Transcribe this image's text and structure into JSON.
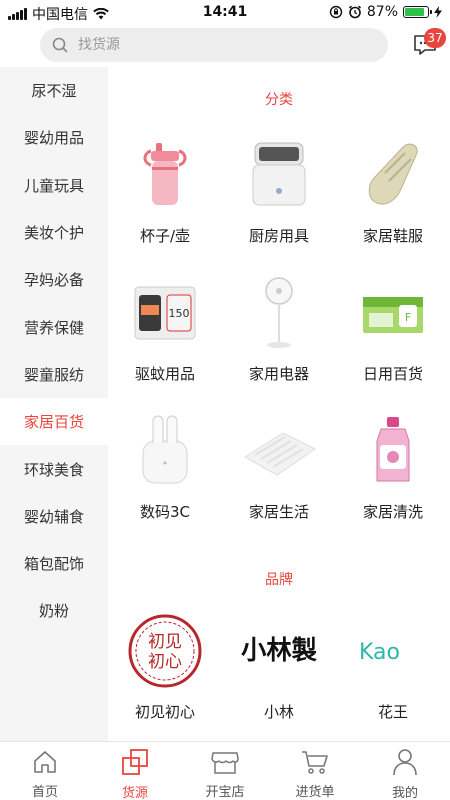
{
  "status_bar": {
    "carrier": "中国电信",
    "time": "14:41",
    "battery": "87%",
    "battery_level": 0.87
  },
  "search": {
    "placeholder": "找货源"
  },
  "messages": {
    "badge_count": "37"
  },
  "sidebar": {
    "items": [
      {
        "label": "尿不湿"
      },
      {
        "label": "婴幼用品"
      },
      {
        "label": "儿童玩具"
      },
      {
        "label": "美妆个护"
      },
      {
        "label": "孕妈必备"
      },
      {
        "label": "营养保健"
      },
      {
        "label": "婴童服纺"
      },
      {
        "label": "家居百货"
      },
      {
        "label": "环球美食"
      },
      {
        "label": "婴幼辅食"
      },
      {
        "label": "箱包配饰"
      },
      {
        "label": "奶粉"
      }
    ],
    "active_label": "家居百货"
  },
  "main": {
    "category_title": "分类",
    "categories": [
      {
        "label": "杯子/壶",
        "icon": "sippy-cup-icon"
      },
      {
        "label": "厨房用具",
        "icon": "sterilizer-icon"
      },
      {
        "label": "家居鞋服",
        "icon": "slipper-icon"
      },
      {
        "label": "驱蚊用品",
        "icon": "mosquito-repellent-icon"
      },
      {
        "label": "家用电器",
        "icon": "fan-icon"
      },
      {
        "label": "日用百货",
        "icon": "goods-box-icon"
      },
      {
        "label": "数码3C",
        "icon": "earbuds-icon"
      },
      {
        "label": "家居生活",
        "icon": "mattress-icon"
      },
      {
        "label": "家居清洗",
        "icon": "detergent-bottle-icon"
      }
    ],
    "brand_title": "品牌",
    "brands": [
      {
        "label": "初见初心",
        "logo_text": "初见初心"
      },
      {
        "label": "小林",
        "logo_text": "小林製"
      },
      {
        "label": "花王",
        "logo_text": "Kao"
      }
    ]
  },
  "tab_bar": {
    "tabs": [
      {
        "label": "首页",
        "icon": "home-icon"
      },
      {
        "label": "货源",
        "icon": "source-icon"
      },
      {
        "label": "开宝店",
        "icon": "store-icon"
      },
      {
        "label": "进货单",
        "icon": "cart-icon"
      },
      {
        "label": "我的",
        "icon": "profile-icon"
      }
    ],
    "active_label": "货源"
  },
  "colors": {
    "accent": "#e8453c",
    "sidebar_bg": "#f5f5f5",
    "search_bg": "#ededed"
  }
}
